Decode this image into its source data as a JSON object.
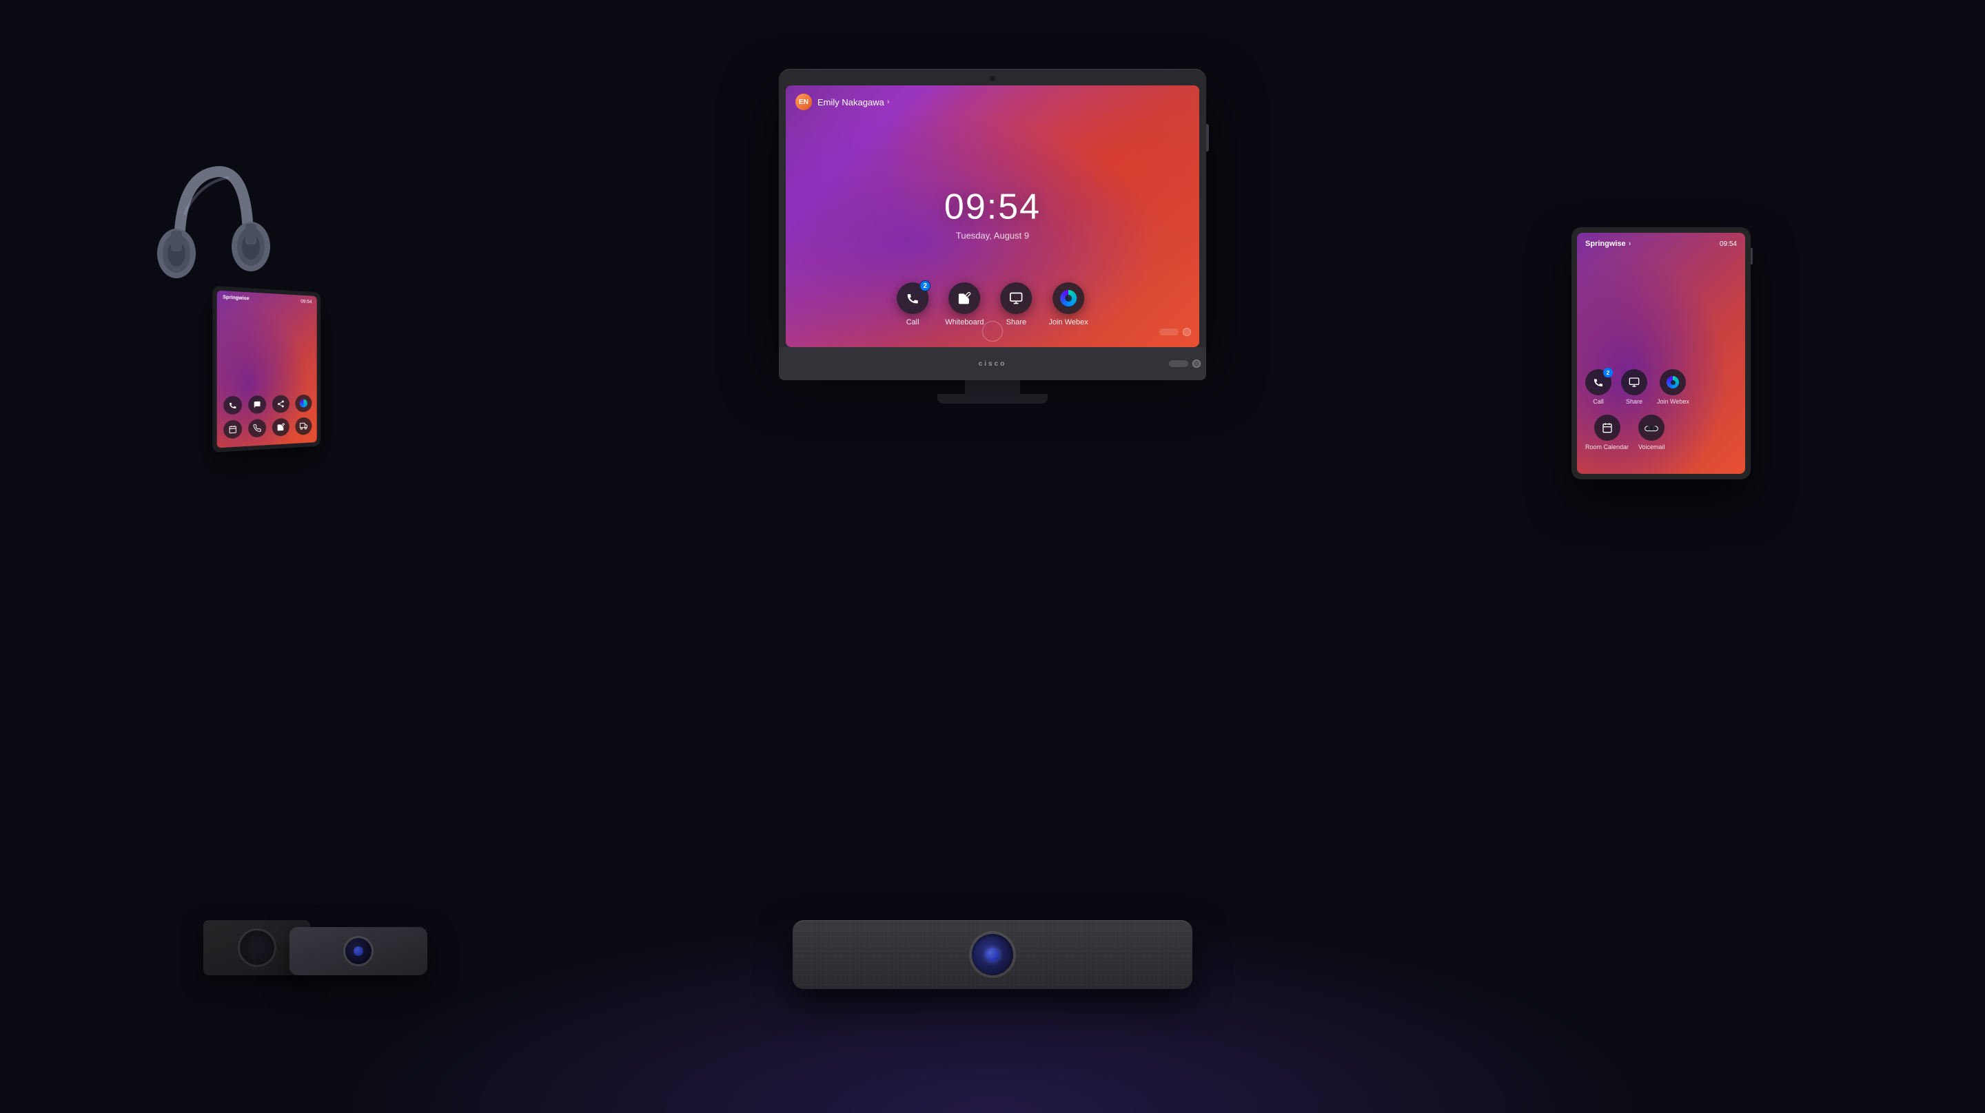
{
  "background": "#0a0a12",
  "main_monitor": {
    "user_name": "Emily Nakagawa",
    "clock_time": "09:54",
    "clock_date": "Tuesday, August 9",
    "apps": [
      {
        "id": "call",
        "label": "Call",
        "badge": "2",
        "icon": "call"
      },
      {
        "id": "whiteboard",
        "label": "Whiteboard",
        "badge": null,
        "icon": "whiteboard"
      },
      {
        "id": "share",
        "label": "Share",
        "badge": null,
        "icon": "share"
      },
      {
        "id": "join-webex",
        "label": "Join Webex",
        "badge": null,
        "icon": "webex"
      }
    ],
    "cisco_label": "cisco"
  },
  "tablet_right": {
    "org_name": "Springwise",
    "time": "09:54",
    "apps_row1": [
      {
        "id": "call",
        "label": "Call",
        "badge": "2",
        "icon": "call"
      },
      {
        "id": "share",
        "label": "Share",
        "badge": null,
        "icon": "share"
      },
      {
        "id": "join-webex",
        "label": "Join Webex",
        "badge": null,
        "icon": "webex"
      }
    ],
    "apps_row2": [
      {
        "id": "room-calendar",
        "label": "Room Calendar",
        "badge": null,
        "icon": "calendar"
      },
      {
        "id": "voicemail",
        "label": "Voicemail",
        "badge": null,
        "icon": "voicemail"
      }
    ]
  },
  "tablet_left": {
    "org_name": "Springwise",
    "time": "09:54"
  },
  "video_bar": {
    "lens_label": "Camera lens"
  },
  "headphones": {
    "label": "Cisco headphones"
  }
}
